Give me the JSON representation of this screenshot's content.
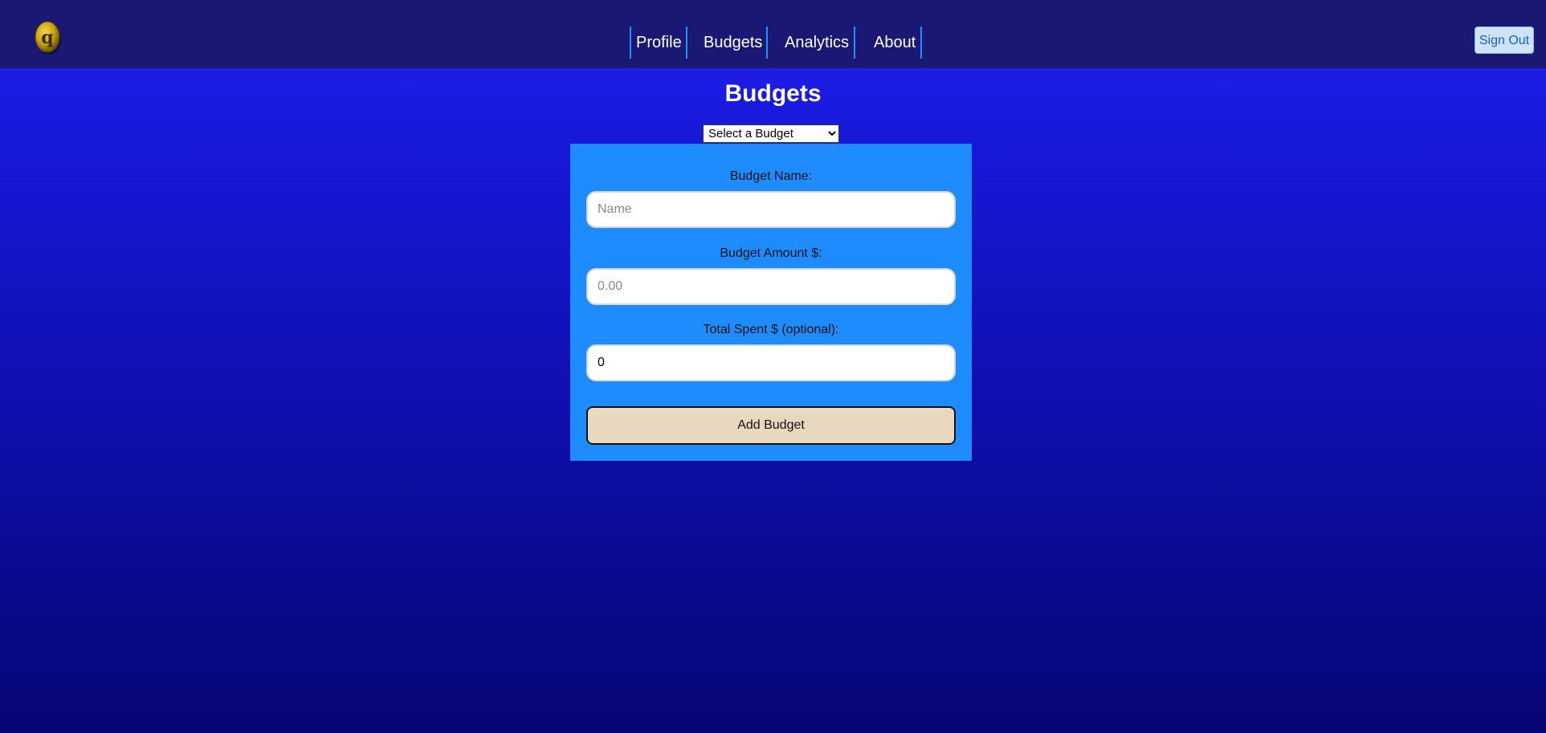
{
  "nav": {
    "links": [
      "Profile",
      "Budgets",
      "Analytics",
      "About"
    ],
    "sign_out": "Sign Out"
  },
  "page": {
    "title": "Budgets"
  },
  "budget_select": {
    "selected": "Select a Budget"
  },
  "form": {
    "name_label": "Budget Name:",
    "name_placeholder": "Name",
    "amount_label": "Budget Amount $:",
    "amount_placeholder": "0.00",
    "spent_label": "Total Spent $ (optional):",
    "spent_value": "0",
    "submit_label": "Add Budget"
  },
  "colors": {
    "navbar": "#1a1873",
    "panel": "#1e8cff",
    "button": "#e8d8c0",
    "nav_divider": "#1e90ff"
  }
}
